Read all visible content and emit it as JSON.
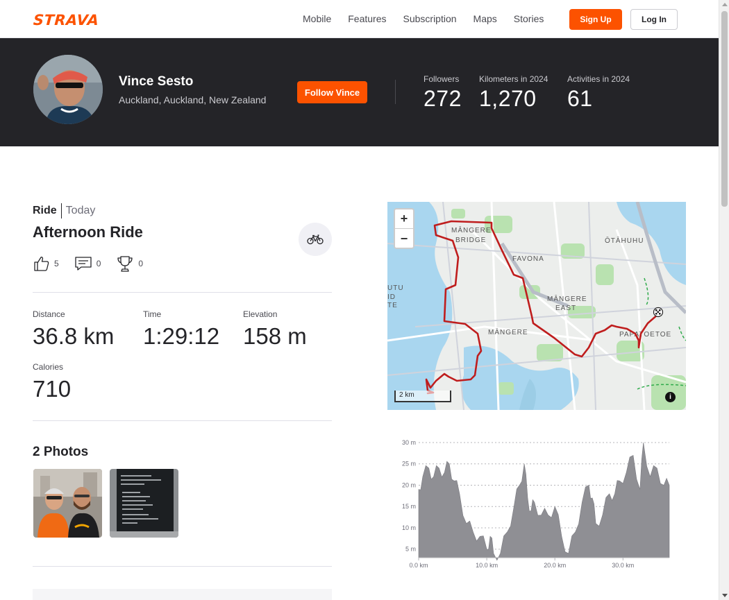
{
  "nav": {
    "logo": "STRAVA",
    "links": [
      "Mobile",
      "Features",
      "Subscription",
      "Maps",
      "Stories"
    ],
    "signup": "Sign Up",
    "login": "Log In"
  },
  "athlete": {
    "name": "Vince Sesto",
    "location": "Auckland, Auckland, New Zealand",
    "follow": "Follow Vince",
    "stats": [
      {
        "label": "Followers",
        "value": "272"
      },
      {
        "label": "Kilometers in 2024",
        "value": "1,270"
      },
      {
        "label": "Activities in 2024",
        "value": "61"
      }
    ]
  },
  "activity": {
    "type": "Ride",
    "when": "Today",
    "title": "Afternoon Ride",
    "kudos": "5",
    "comments": "0",
    "achievements": "0",
    "metrics": {
      "distance": {
        "label": "Distance",
        "value": "36.8 km"
      },
      "time": {
        "label": "Time",
        "value": "1:29:12"
      },
      "elevation": {
        "label": "Elevation",
        "value": "158 m"
      },
      "calories": {
        "label": "Calories",
        "value": "710"
      }
    },
    "photos_title": "2 Photos"
  },
  "map": {
    "labels": [
      "MĀNGERE\nBRIDGE",
      "FAVONA",
      "ŌTĀHUHU",
      "MĀNGERE\nEAST",
      "MĀNGERE",
      "PAPATOETOE",
      "UTU\nID\nTE"
    ],
    "zoom_in": "+",
    "zoom_out": "−",
    "scale": "2 km",
    "info": "i",
    "route_color": "#c8102e"
  },
  "chart_data": {
    "type": "area",
    "xlabel": "",
    "ylabel": "",
    "x_ticks": [
      "0.0 km",
      "10.0 km",
      "20.0 km",
      "30.0 km"
    ],
    "y_ticks": [
      "5 m",
      "10 m",
      "15 m",
      "20 m",
      "25 m",
      "30 m"
    ],
    "xlim": [
      0,
      36.8
    ],
    "ylim": [
      3,
      30
    ],
    "fill_color": "#8f8f94",
    "x": [
      0,
      0.6,
      1.5,
      2.2,
      3,
      3.8,
      4.5,
      5.2,
      6,
      7,
      8,
      9,
      10,
      10.5,
      11,
      12,
      13,
      14,
      14.8,
      15.5,
      16,
      16.5,
      17,
      18,
      19,
      20,
      21,
      22,
      23,
      24,
      25,
      25.5,
      26,
      27,
      28,
      28.8,
      29.5,
      30.5,
      31.5,
      32.5,
      33,
      34,
      35,
      36,
      36.8
    ],
    "values": [
      19,
      22,
      24,
      22,
      24,
      23,
      25,
      21,
      18,
      11,
      9,
      8,
      5,
      8,
      4,
      4,
      9,
      15,
      20,
      25,
      17,
      14,
      16,
      13,
      13,
      15,
      8,
      4,
      9,
      16,
      20,
      17,
      11,
      13,
      18,
      18,
      21,
      23,
      27,
      19,
      30,
      22,
      24,
      20,
      20
    ]
  }
}
